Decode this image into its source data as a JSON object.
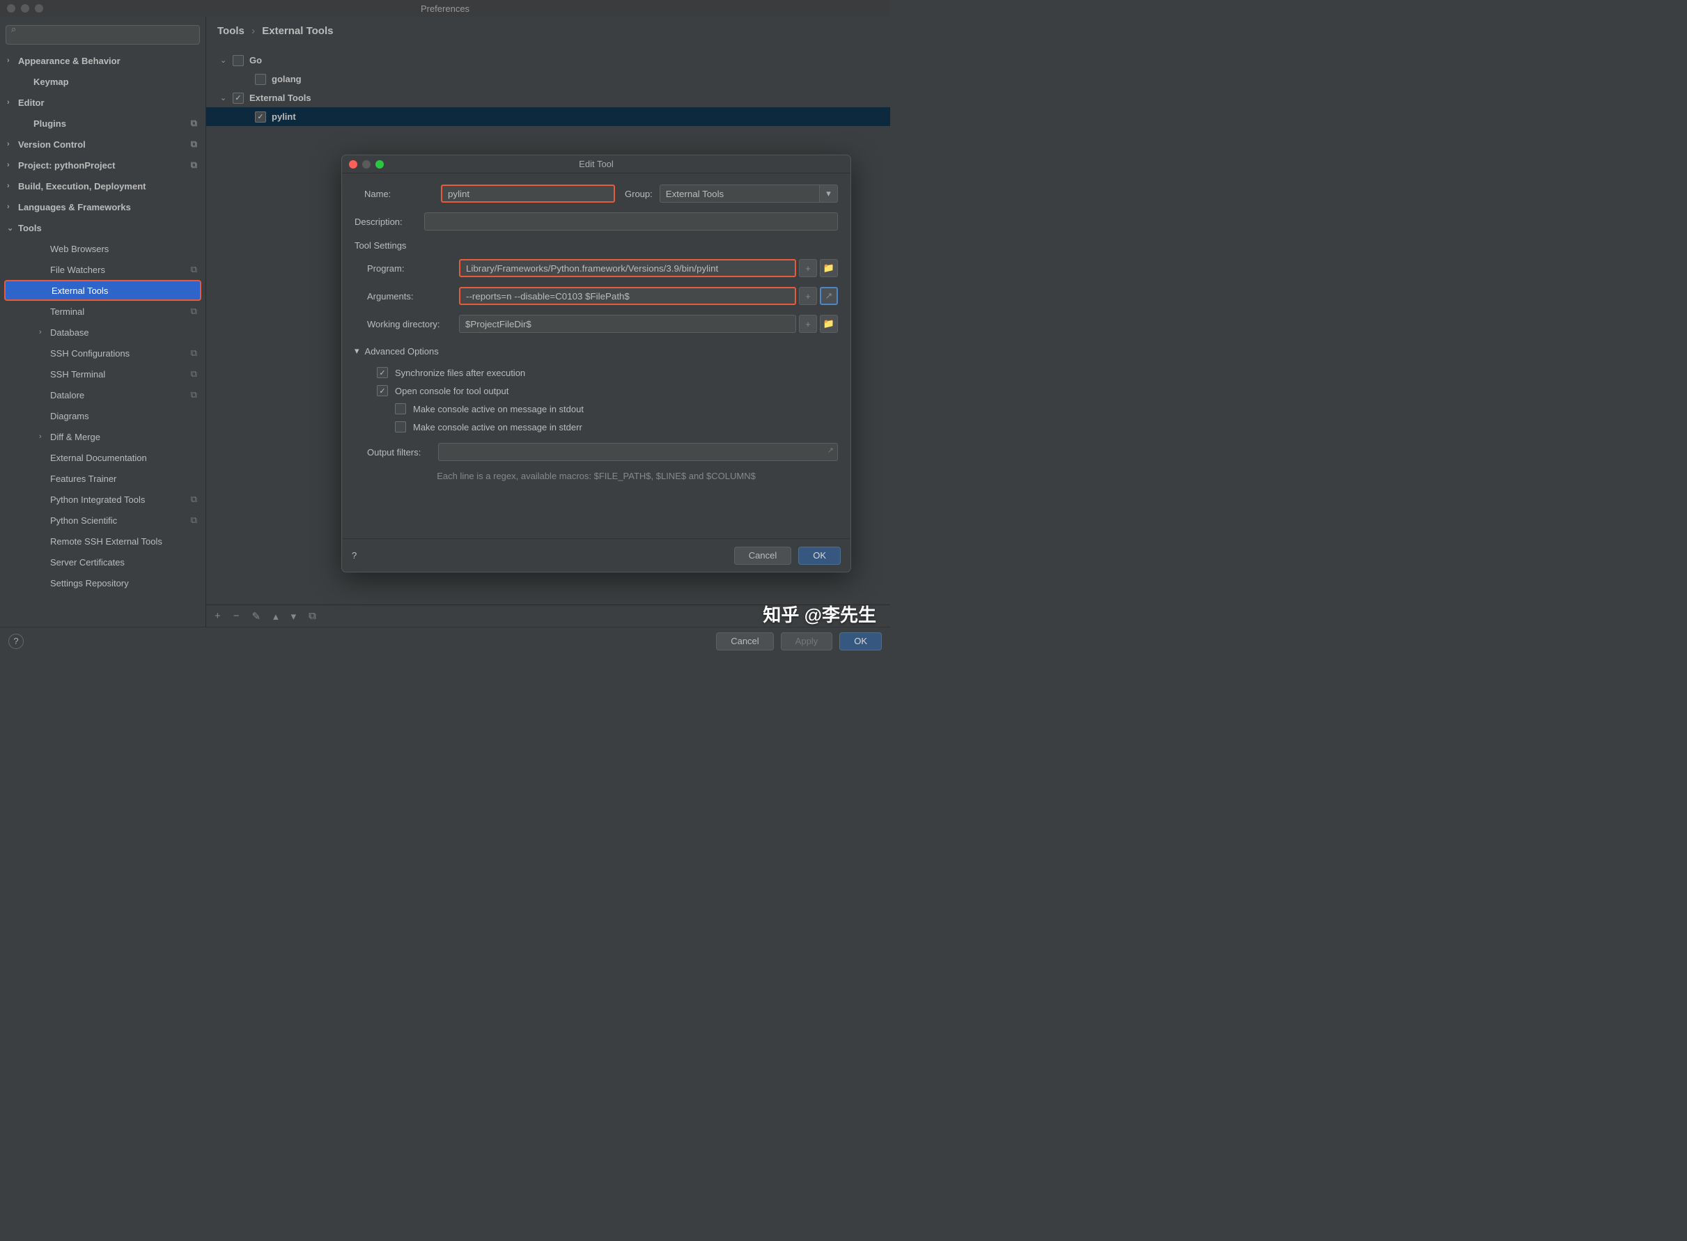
{
  "window": {
    "title": "Preferences"
  },
  "search": {
    "placeholder": ""
  },
  "sidebar": {
    "items": [
      {
        "label": "Appearance & Behavior",
        "bold": true,
        "chev": "›"
      },
      {
        "label": "Keymap",
        "bold": true,
        "indent": 1
      },
      {
        "label": "Editor",
        "bold": true,
        "chev": "›"
      },
      {
        "label": "Plugins",
        "bold": true,
        "indent": 1,
        "copy": true
      },
      {
        "label": "Version Control",
        "bold": true,
        "chev": "›",
        "copy": true
      },
      {
        "label": "Project: pythonProject",
        "bold": true,
        "chev": "›",
        "copy": true
      },
      {
        "label": "Build, Execution, Deployment",
        "bold": true,
        "chev": "›"
      },
      {
        "label": "Languages & Frameworks",
        "bold": true,
        "chev": "›"
      },
      {
        "label": "Tools",
        "bold": true,
        "chev": "⌄"
      },
      {
        "label": "Web Browsers",
        "indent": 2
      },
      {
        "label": "File Watchers",
        "indent": 2,
        "copy": true
      },
      {
        "label": "External Tools",
        "indent": 2,
        "selected": true
      },
      {
        "label": "Terminal",
        "indent": 2,
        "copy": true
      },
      {
        "label": "Database",
        "indent": 2,
        "chev": "›"
      },
      {
        "label": "SSH Configurations",
        "indent": 2,
        "copy": true
      },
      {
        "label": "SSH Terminal",
        "indent": 2,
        "copy": true
      },
      {
        "label": "Datalore",
        "indent": 2,
        "copy": true
      },
      {
        "label": "Diagrams",
        "indent": 2
      },
      {
        "label": "Diff & Merge",
        "indent": 2,
        "chev": "›"
      },
      {
        "label": "External Documentation",
        "indent": 2
      },
      {
        "label": "Features Trainer",
        "indent": 2
      },
      {
        "label": "Python Integrated Tools",
        "indent": 2,
        "copy": true
      },
      {
        "label": "Python Scientific",
        "indent": 2,
        "copy": true
      },
      {
        "label": "Remote SSH External Tools",
        "indent": 2
      },
      {
        "label": "Server Certificates",
        "indent": 2
      },
      {
        "label": "Settings Repository",
        "indent": 2
      }
    ]
  },
  "breadcrumb": {
    "a": "Tools",
    "sep": "›",
    "b": "External Tools"
  },
  "tree": {
    "rows": [
      {
        "label": "Go",
        "depth": 0,
        "chev": "⌄",
        "checked": false
      },
      {
        "label": "golang",
        "depth": 1,
        "checked": false
      },
      {
        "label": "External Tools",
        "depth": 0,
        "chev": "⌄",
        "checked": true
      },
      {
        "label": "pylint",
        "depth": 1,
        "checked": true,
        "selected": true
      }
    ]
  },
  "toolbar": {
    "add": "+",
    "remove": "−",
    "edit": "✎",
    "up": "▴",
    "down": "▾",
    "copy": "⧉"
  },
  "footer": {
    "cancel": "Cancel",
    "apply": "Apply",
    "ok": "OK"
  },
  "dialog": {
    "title": "Edit Tool",
    "name_label": "Name:",
    "name_value": "pylint",
    "group_label": "Group:",
    "group_value": "External Tools",
    "desc_label": "Description:",
    "desc_value": "",
    "section": "Tool Settings",
    "program_label": "Program:",
    "program_value": "Library/Frameworks/Python.framework/Versions/3.9/bin/pylint",
    "args_label": "Arguments:",
    "args_value": "--reports=n --disable=C0103 $FilePath$",
    "wd_label": "Working directory:",
    "wd_value": "$ProjectFileDir$",
    "adv": "Advanced Options",
    "opt_sync": "Synchronize files after execution",
    "opt_console": "Open console for tool output",
    "opt_stdout": "Make console active on message in stdout",
    "opt_stderr": "Make console active on message in stderr",
    "filters_label": "Output filters:",
    "filters_value": "",
    "hint": "Each line is a regex, available macros: $FILE_PATH$, $LINE$ and $COLUMN$",
    "cancel": "Cancel",
    "ok": "OK"
  },
  "watermark": "知乎 @李先生"
}
